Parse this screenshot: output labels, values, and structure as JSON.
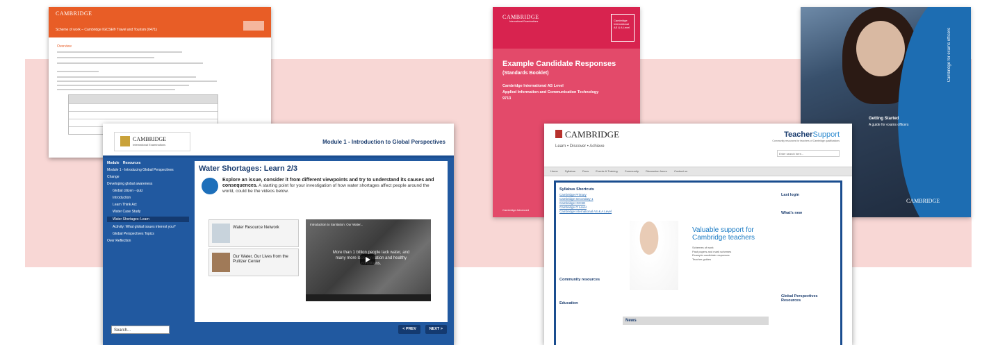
{
  "scheme_of_work": {
    "logo": "CAMBRIDGE",
    "title": "Scheme of work – Cambridge IGCSE® Travel and Tourism (0471)",
    "section_heading": "Overview"
  },
  "module": {
    "logo": "CAMBRIDGE",
    "logo_sub": "International Examinations",
    "heading": "Module 1 - Introduction to Global Perspectives",
    "tabs": [
      "Module",
      "Resources"
    ],
    "nav": [
      "Module 1 - Introducing Global Perspectives",
      "Change",
      "Developing global awareness",
      "Global citizen - quiz",
      "Introduction",
      "Learn Think Act",
      "Water Case Study",
      "Water Shortages: Learn",
      "Activity: What global issues interest you?",
      "Global Perspectives Topics",
      "Over Reflection"
    ],
    "active_nav_index": 7,
    "title": "Water Shortages: Learn 2/3",
    "intro_bold": "Explore an issue, consider it from different viewpoints and try to understand its causes and consequences.",
    "intro_rest": "A starting point for your investigation of how water shortages affect people around the world, could be the videos below.",
    "resource_cards": [
      "Water Resource Network",
      "Our Water, Our Lives from the Pulitzer Center"
    ],
    "video_title": "Introduction to Sanitation: Our Water...",
    "video_caption": "More than 1 billion people lack water, and many more lack sanitation and healthy conditions.",
    "search_placeholder": "Search...",
    "prev_label": "< PREV",
    "next_label": "NEXT >"
  },
  "ecr_booklet": {
    "logo": "CAMBRIDGE",
    "logo_sub": "International Examinations",
    "level_box": "Cambridge International AS & A Level",
    "title": "Example Candidate Responses",
    "subtitle": "(Standards Booklet)",
    "lines": [
      "Cambridge International AS Level",
      "Applied Information and Communication Technology",
      "9713"
    ],
    "footer": "Cambridge Advanced"
  },
  "exams_guide": {
    "spine": "Cambridge for exams officers",
    "title": "Getting Started",
    "subtitle": "A guide for exams officers",
    "logo": "CAMBRIDGE"
  },
  "teacher_support": {
    "logo": "CAMBRIDGE",
    "tagline": "Learn • Discover • Achieve",
    "brand_main": "Teacher",
    "brand_accent": "Support",
    "brand_desc": "Community resources for teachers of Cambridge qualifications",
    "search_placeholder": "Enter search here...",
    "nav": [
      "Home",
      "Syllabus",
      "Docs",
      "Events & Training",
      "Community",
      "Discussion forum",
      "Contact us"
    ],
    "left_heading": "Syllabus Shortcuts",
    "left_links": [
      "Cambridge Primary",
      "Cambridge Secondary 1",
      "Cambridge IGCSE",
      "Cambridge O Level",
      "Cambridge International AS & A Level"
    ],
    "community_heading": "Community resources",
    "education_heading": "Education",
    "hero_title": "Valuable support for Cambridge teachers",
    "hero_bullets": [
      "Schemes of work",
      "Past papers and mark schemes",
      "Example candidate responses",
      "Teacher guides"
    ],
    "login_heading": "Last login",
    "whats_new_heading": "What's new",
    "news_heading": "News",
    "gp_heading": "Global Perspectives Resources"
  }
}
